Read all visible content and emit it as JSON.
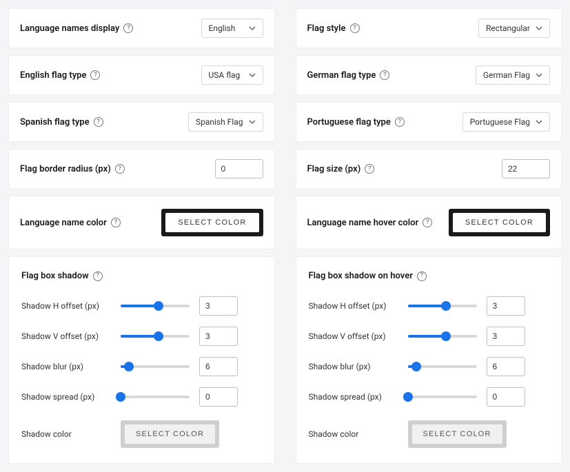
{
  "settings": {
    "language_names_display": {
      "label": "Language names display",
      "value": "English"
    },
    "flag_style": {
      "label": "Flag style",
      "value": "Rectangular"
    },
    "english_flag_type": {
      "label": "English flag type",
      "value": "USA flag"
    },
    "german_flag_type": {
      "label": "German flag type",
      "value": "German Flag"
    },
    "spanish_flag_type": {
      "label": "Spanish flag type",
      "value": "Spanish Flag"
    },
    "portuguese_flag_type": {
      "label": "Portuguese flag type",
      "value": "Portuguese Flag"
    },
    "flag_border_radius": {
      "label": "Flag border radius (px)",
      "value": "0"
    },
    "flag_size": {
      "label": "Flag size (px)",
      "value": "22"
    },
    "language_name_color": {
      "label": "Language name color",
      "button": "SELECT COLOR"
    },
    "language_name_hover_color": {
      "label": "Language name hover color",
      "button": "SELECT COLOR"
    }
  },
  "shadow_left": {
    "title": "Flag box shadow",
    "h_offset": {
      "label": "Shadow H offset (px)",
      "value": "3",
      "pct": 55
    },
    "v_offset": {
      "label": "Shadow V offset (px)",
      "value": "3",
      "pct": 55
    },
    "blur": {
      "label": "Shadow blur (px)",
      "value": "6",
      "pct": 12
    },
    "spread": {
      "label": "Shadow spread (px)",
      "value": "0",
      "pct": 0
    },
    "color": {
      "label": "Shadow color",
      "button": "SELECT COLOR"
    }
  },
  "shadow_right": {
    "title": "Flag box shadow on hover",
    "h_offset": {
      "label": "Shadow H offset (px)",
      "value": "3",
      "pct": 55
    },
    "v_offset": {
      "label": "Shadow V offset (px)",
      "value": "3",
      "pct": 55
    },
    "blur": {
      "label": "Shadow blur (px)",
      "value": "6",
      "pct": 12
    },
    "spread": {
      "label": "Shadow spread (px)",
      "value": "0",
      "pct": 0
    },
    "color": {
      "label": "Shadow color",
      "button": "SELECT COLOR"
    }
  }
}
